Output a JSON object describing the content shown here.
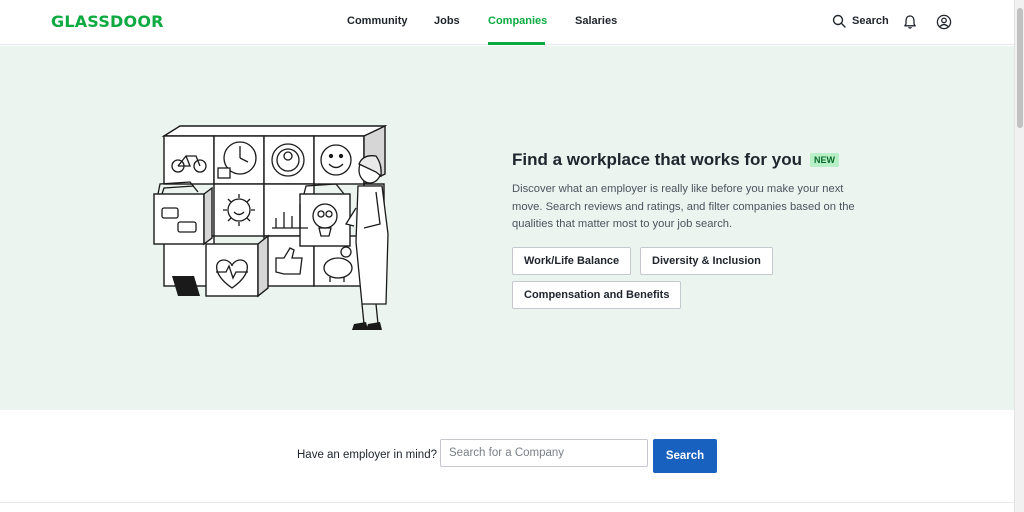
{
  "header": {
    "logo": "GLASSDOOR",
    "nav": [
      {
        "label": "Community",
        "active": false
      },
      {
        "label": "Jobs",
        "active": false
      },
      {
        "label": "Companies",
        "active": true
      },
      {
        "label": "Salaries",
        "active": false
      }
    ],
    "search_label": "Search",
    "icons": [
      "search-icon",
      "bell-icon",
      "account-icon"
    ]
  },
  "hero": {
    "title": "Find a workplace that works for you",
    "badge": "NEW",
    "description": "Discover what an employer is really like before you make your next move. Search reviews and ratings, and filter companies based on the qualities that matter most to your job search.",
    "chips": [
      "Work/Life Balance",
      "Diversity & Inclusion",
      "Compensation and Benefits"
    ]
  },
  "employer_search": {
    "prompt": "Have an employer in mind?",
    "placeholder": "Search for a Company",
    "button": "Search"
  },
  "colors": {
    "brand_green": "#0caa41",
    "hero_bg": "#ebf4ee",
    "button_blue": "#1861bf",
    "badge_bg": "#b7f0c6"
  }
}
